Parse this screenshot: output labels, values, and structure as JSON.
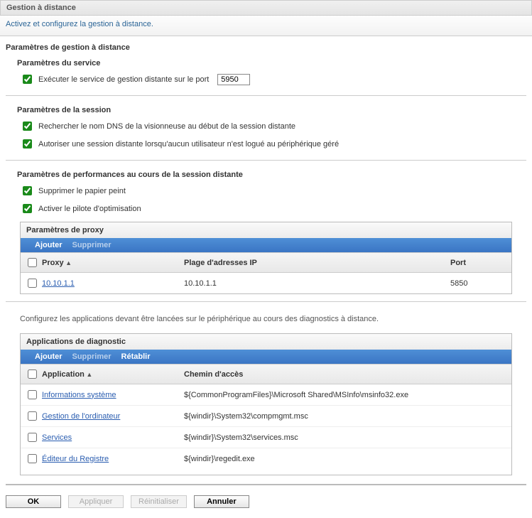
{
  "header": {
    "title": "Gestion à distance",
    "subtitle": "Activez et configurez la gestion à distance."
  },
  "section": {
    "main_title": "Paramètres de gestion à distance",
    "service": {
      "heading": "Paramètres du service",
      "run_label": "Exécuter le service de gestion distante sur le port",
      "port": "5950"
    },
    "session": {
      "heading": "Paramètres de la session",
      "dns_label": "Rechercher le nom DNS de la visionneuse au début de la session distante",
      "nouser_label": "Autoriser une session distante lorsqu'aucun utilisateur n'est logué au périphérique géré"
    },
    "perf": {
      "heading": "Paramètres de performances au cours de la session distante",
      "wallpaper_label": "Supprimer le papier peint",
      "driver_label": "Activer le pilote d'optimisation"
    }
  },
  "proxy": {
    "title": "Paramètres de proxy",
    "actions": {
      "add": "Ajouter",
      "delete": "Supprimer"
    },
    "cols": {
      "proxy": "Proxy",
      "iprange": "Plage d'adresses IP",
      "port": "Port"
    },
    "rows": [
      {
        "proxy": "10.10.1.1",
        "iprange": "10.10.1.1",
        "port": "5850"
      }
    ]
  },
  "diag": {
    "desc": "Configurez les applications devant être lancées sur le périphérique au cours des diagnostics à distance.",
    "title": "Applications de diagnostic",
    "actions": {
      "add": "Ajouter",
      "delete": "Supprimer",
      "restore": "Rétablir"
    },
    "cols": {
      "app": "Application",
      "path": "Chemin d'accès"
    },
    "rows": [
      {
        "app": "Informations système",
        "path": "${CommonProgramFiles}\\Microsoft Shared\\MSInfo\\msinfo32.exe"
      },
      {
        "app": "Gestion de l'ordinateur",
        "path": "${windir}\\System32\\compmgmt.msc"
      },
      {
        "app": "Services",
        "path": "${windir}\\System32\\services.msc"
      },
      {
        "app": "Éditeur du Registre",
        "path": "${windir}\\regedit.exe"
      }
    ]
  },
  "buttons": {
    "ok": "OK",
    "apply": "Appliquer",
    "reset": "Réinitialiser",
    "cancel": "Annuler"
  }
}
